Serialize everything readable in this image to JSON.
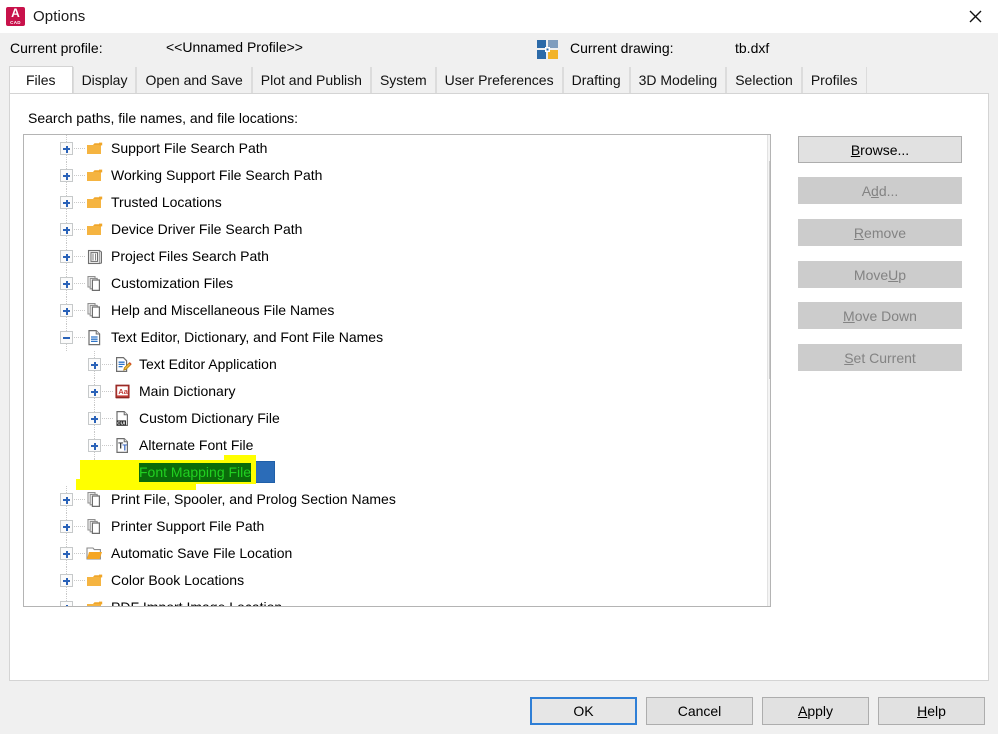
{
  "window": {
    "title": "Options",
    "app_icon": "autocad-icon",
    "app_icon_letter": "A",
    "app_icon_sub": "CAD",
    "close_label": "✕",
    "accent_color": "#c8124b"
  },
  "profile": {
    "label": "Current profile:",
    "value": "<<Unnamed Profile>>",
    "drawing_label": "Current drawing:",
    "drawing_value": "tb.dxf"
  },
  "tabs": [
    {
      "label": "Files",
      "active": true
    },
    {
      "label": "Display",
      "active": false
    },
    {
      "label": "Open and Save",
      "active": false
    },
    {
      "label": "Plot and Publish",
      "active": false
    },
    {
      "label": "System",
      "active": false
    },
    {
      "label": "User Preferences",
      "active": false
    },
    {
      "label": "Drafting",
      "active": false
    },
    {
      "label": "3D Modeling",
      "active": false
    },
    {
      "label": "Selection",
      "active": false
    },
    {
      "label": "Profiles",
      "active": false
    }
  ],
  "panel": {
    "label": "Search paths, file names, and file locations:"
  },
  "tree": {
    "selected": "Font Mapping File",
    "selection_text_color": "#21d021",
    "selection_box_color": "#2b6cb8",
    "marker_color": "#ffff00",
    "nodes": [
      {
        "label": "Support File Search Path",
        "depth": 1,
        "expander": "plus",
        "icon": "folder-icon"
      },
      {
        "label": "Working Support File Search Path",
        "depth": 1,
        "expander": "plus",
        "icon": "folder-icon"
      },
      {
        "label": "Trusted Locations",
        "depth": 1,
        "expander": "plus",
        "icon": "folder-icon"
      },
      {
        "label": "Device Driver File Search Path",
        "depth": 1,
        "expander": "plus",
        "icon": "folder-icon"
      },
      {
        "label": "Project Files Search Path",
        "depth": 1,
        "expander": "plus",
        "icon": "project-database-icon"
      },
      {
        "label": "Customization Files",
        "depth": 1,
        "expander": "plus",
        "icon": "stacked-pages-icon"
      },
      {
        "label": "Help and Miscellaneous File Names",
        "depth": 1,
        "expander": "plus",
        "icon": "stacked-pages-icon"
      },
      {
        "label": "Text Editor, Dictionary, and Font File Names",
        "depth": 1,
        "expander": "minus",
        "icon": "lined-document-icon"
      },
      {
        "label": "Text Editor Application",
        "depth": 2,
        "expander": "plus",
        "icon": "text-editor-pencil-icon"
      },
      {
        "label": "Main Dictionary",
        "depth": 2,
        "expander": "plus",
        "icon": "dictionary-book-icon"
      },
      {
        "label": "Custom Dictionary File",
        "depth": 2,
        "expander": "plus",
        "icon": "cui-document-icon"
      },
      {
        "label": "Alternate Font File",
        "depth": 2,
        "expander": "plus",
        "icon": "font-tt-icon"
      },
      {
        "label": "Font Mapping File",
        "depth": 2,
        "expander": "plus",
        "icon": "psf-document-icon",
        "selected": true,
        "marked": true
      },
      {
        "label": "Print File, Spooler, and Prolog Section Names",
        "depth": 1,
        "expander": "plus",
        "icon": "stacked-pages-icon"
      },
      {
        "label": "Printer Support File Path",
        "depth": 1,
        "expander": "plus",
        "icon": "stacked-pages-icon"
      },
      {
        "label": "Automatic Save File Location",
        "depth": 1,
        "expander": "plus",
        "icon": "folder-open-icon"
      },
      {
        "label": "Color Book Locations",
        "depth": 1,
        "expander": "plus",
        "icon": "folder-icon"
      },
      {
        "label": "PDF Import Image Location",
        "depth": 1,
        "expander": "plus",
        "icon": "folder-icon",
        "clipped": true
      }
    ]
  },
  "scrollbar": {
    "up_arrow": "⌃",
    "down_arrow": "⌄"
  },
  "side_buttons": [
    {
      "label": "Browse...",
      "mnemonic": "B",
      "disabled": false
    },
    {
      "label": "Add...",
      "mnemonic": "d",
      "disabled": true
    },
    {
      "label": "Remove",
      "mnemonic": "R",
      "disabled": true
    },
    {
      "label": "Move Up",
      "mnemonic": "U",
      "disabled": true
    },
    {
      "label": "Move Down",
      "mnemonic": "M",
      "disabled": true
    },
    {
      "label": "Set Current",
      "mnemonic": "S",
      "disabled": true
    }
  ],
  "footer_buttons": [
    {
      "label": "OK",
      "mnemonic": "",
      "default": true
    },
    {
      "label": "Cancel",
      "mnemonic": "",
      "default": false
    },
    {
      "label": "Apply",
      "mnemonic": "A",
      "default": false
    },
    {
      "label": "Help",
      "mnemonic": "H",
      "default": false
    }
  ]
}
